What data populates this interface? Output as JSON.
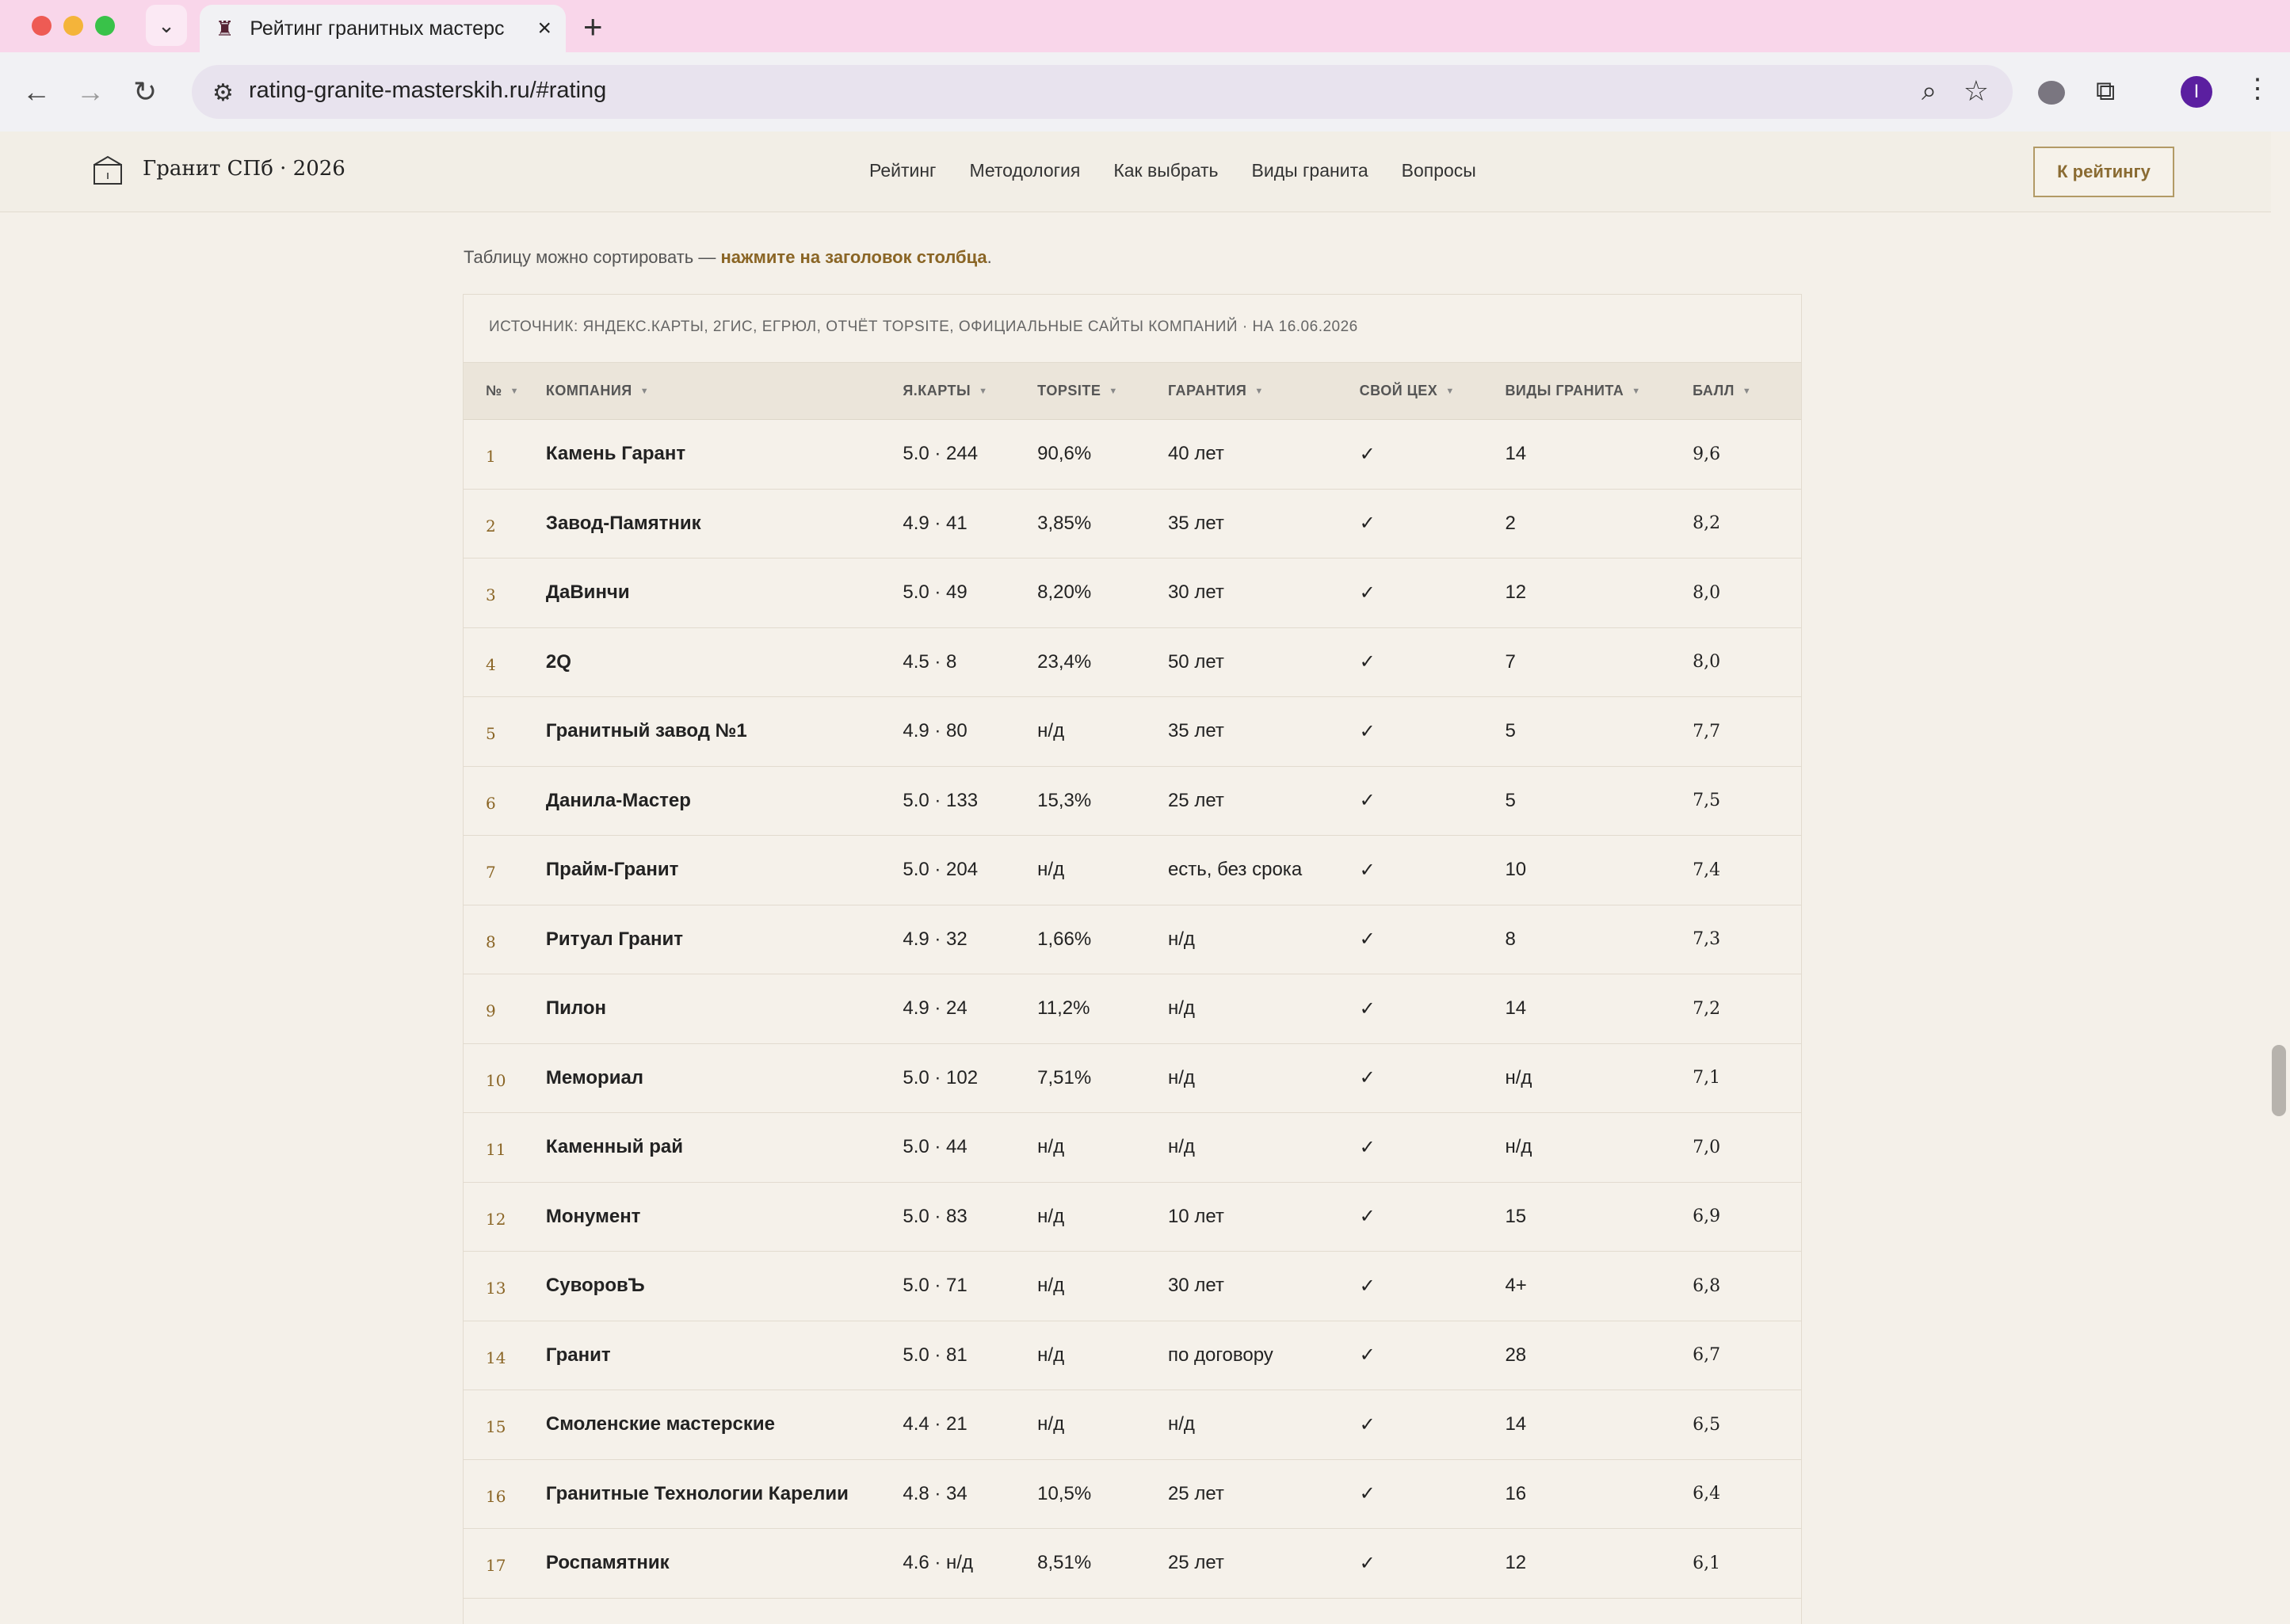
{
  "browser": {
    "tab_title": "Рейтинг гранитных мастерс",
    "url": "rating-granite-masterskih.ru/#rating",
    "avatar_letter": "I"
  },
  "site": {
    "logo_text": "Гранит СПб · 2026",
    "nav": [
      "Рейтинг",
      "Методология",
      "Как выбрать",
      "Виды гранита",
      "Вопросы"
    ],
    "cta_label": "К рейтингу",
    "hint_prefix": "Таблицу можно сортировать — ",
    "hint_link": "нажмите на заголовок столбца",
    "hint_suffix": "."
  },
  "table": {
    "source": "ИСТОЧНИК: ЯНДЕКС.КАРТЫ, 2ГИС, ЕГРЮЛ, ОТЧЁТ TOPSITE, ОФИЦИАЛЬНЫЕ САЙТЫ КОМПАНИЙ · НА 16.06.2026",
    "headers": [
      "№",
      "КОМПАНИЯ",
      "Я.КАРТЫ",
      "TOPSITE",
      "ГАРАНТИЯ",
      "СВОЙ ЦЕХ",
      "ВИДЫ ГРАНИТА",
      "БАЛЛ"
    ],
    "rows": [
      {
        "num": "1",
        "company": "Камень Гарант",
        "ymaps": "5.0 · 244",
        "topsite": "90,6%",
        "warranty": "40 лет",
        "workshop": "✓",
        "granite": "14",
        "score": "9,6"
      },
      {
        "num": "2",
        "company": "Завод-Памятник",
        "ymaps": "4.9 · 41",
        "topsite": "3,85%",
        "warranty": "35 лет",
        "workshop": "✓",
        "granite": "2",
        "score": "8,2"
      },
      {
        "num": "3",
        "company": "ДаВинчи",
        "ymaps": "5.0 · 49",
        "topsite": "8,20%",
        "warranty": "30 лет",
        "workshop": "✓",
        "granite": "12",
        "score": "8,0"
      },
      {
        "num": "4",
        "company": "2Q",
        "ymaps": "4.5 · 8",
        "topsite": "23,4%",
        "warranty": "50 лет",
        "workshop": "✓",
        "granite": "7",
        "score": "8,0"
      },
      {
        "num": "5",
        "company": "Гранитный завод №1",
        "ymaps": "4.9 · 80",
        "topsite": "н/д",
        "warranty": "35 лет",
        "workshop": "✓",
        "granite": "5",
        "score": "7,7"
      },
      {
        "num": "6",
        "company": "Данила-Мастер",
        "ymaps": "5.0 · 133",
        "topsite": "15,3%",
        "warranty": "25 лет",
        "workshop": "✓",
        "granite": "5",
        "score": "7,5"
      },
      {
        "num": "7",
        "company": "Прайм-Гранит",
        "ymaps": "5.0 · 204",
        "topsite": "н/д",
        "warranty": "есть, без срока",
        "workshop": "✓",
        "granite": "10",
        "score": "7,4"
      },
      {
        "num": "8",
        "company": "Ритуал Гранит",
        "ymaps": "4.9 · 32",
        "topsite": "1,66%",
        "warranty": "н/д",
        "workshop": "✓",
        "granite": "8",
        "score": "7,3"
      },
      {
        "num": "9",
        "company": "Пилон",
        "ymaps": "4.9 · 24",
        "topsite": "11,2%",
        "warranty": "н/д",
        "workshop": "✓",
        "granite": "14",
        "score": "7,2"
      },
      {
        "num": "10",
        "company": "Мемориал",
        "ymaps": "5.0 · 102",
        "topsite": "7,51%",
        "warranty": "н/д",
        "workshop": "✓",
        "granite": "н/д",
        "score": "7,1"
      },
      {
        "num": "11",
        "company": "Каменный рай",
        "ymaps": "5.0 · 44",
        "topsite": "н/д",
        "warranty": "н/д",
        "workshop": "✓",
        "granite": "н/д",
        "score": "7,0"
      },
      {
        "num": "12",
        "company": "Монумент",
        "ymaps": "5.0 · 83",
        "topsite": "н/д",
        "warranty": "10 лет",
        "workshop": "✓",
        "granite": "15",
        "score": "6,9"
      },
      {
        "num": "13",
        "company": "СуворовЪ",
        "ymaps": "5.0 · 71",
        "topsite": "н/д",
        "warranty": "30 лет",
        "workshop": "✓",
        "granite": "4+",
        "score": "6,8"
      },
      {
        "num": "14",
        "company": "Гранит",
        "ymaps": "5.0 · 81",
        "topsite": "н/д",
        "warranty": "по договору",
        "workshop": "✓",
        "granite": "28",
        "score": "6,7"
      },
      {
        "num": "15",
        "company": "Смоленские мастерские",
        "ymaps": "4.4 · 21",
        "topsite": "н/д",
        "warranty": "н/д",
        "workshop": "✓",
        "granite": "14",
        "score": "6,5"
      },
      {
        "num": "16",
        "company": "Гранитные Технологии Карелии",
        "ymaps": "4.8 · 34",
        "topsite": "10,5%",
        "warranty": "25 лет",
        "workshop": "✓",
        "granite": "16",
        "score": "6,4"
      },
      {
        "num": "17",
        "company": "Роспамятник",
        "ymaps": "4.6 · н/д",
        "topsite": "8,51%",
        "warranty": "25 лет",
        "workshop": "✓",
        "granite": "12",
        "score": "6,1"
      }
    ]
  },
  "colors": {
    "accent": "#8a6525",
    "browser_frame": "#f9d6ea",
    "page_bg": "#f4f0e9"
  }
}
